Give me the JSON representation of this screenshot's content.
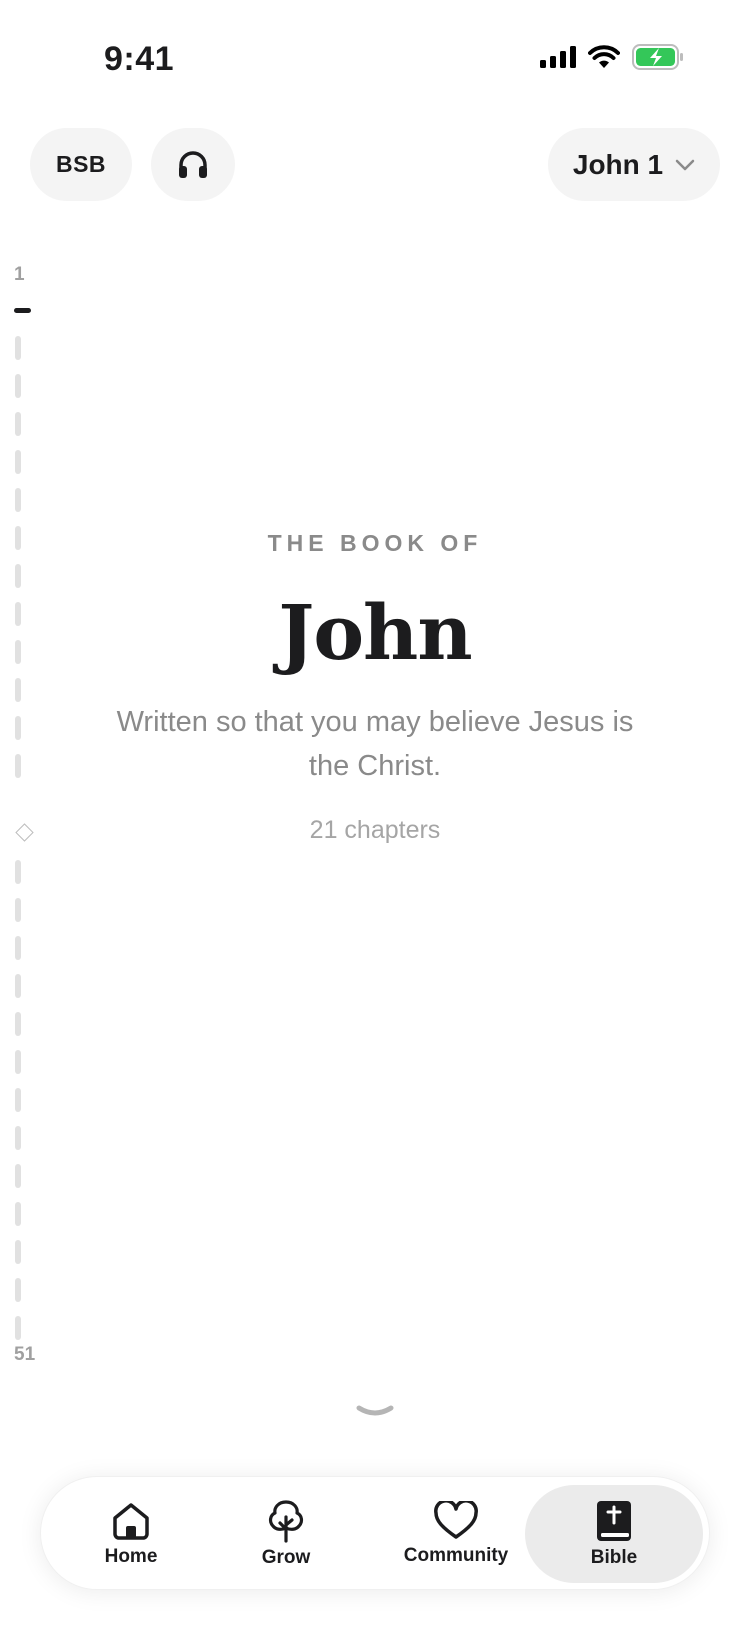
{
  "status_bar": {
    "time": "9:41"
  },
  "header": {
    "translation_label": "BSB",
    "chapter_label": "John 1"
  },
  "chapter_rail": {
    "first_label": "1",
    "last_label": "51"
  },
  "book": {
    "eyebrow": "THE BOOK OF",
    "title": "John",
    "subtitle": "Written so that you may believe Jesus is the Christ.",
    "chapters": "21 chapters"
  },
  "tab_bar": {
    "items": [
      {
        "label": "Home",
        "icon": "home-icon"
      },
      {
        "label": "Grow",
        "icon": "tree-icon"
      },
      {
        "label": "Community",
        "icon": "heart-icon"
      },
      {
        "label": "Bible",
        "icon": "bible-icon",
        "selected": true
      }
    ]
  },
  "colors": {
    "battery": "#34c759",
    "pill_bg": "#f4f4f4",
    "selected_tab_bg": "#ebebeb"
  }
}
